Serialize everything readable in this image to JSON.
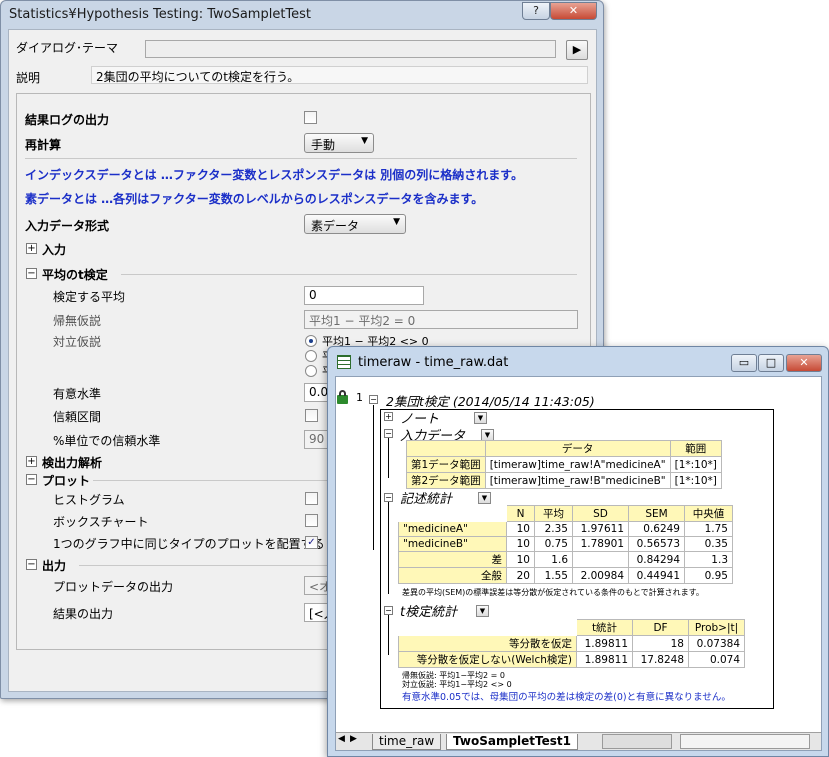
{
  "dialog": {
    "title": "Statistics¥Hypothesis Testing: TwoSampletTest",
    "help_label": "?",
    "close_label": "✕",
    "theme_label": "ダイアログ･テーマ",
    "theme_value": "",
    "theme_arrow": "▶",
    "desc_label": "説明",
    "desc_text": "2集団の平均についてのt検定を行う。",
    "result_log_label": "結果ログの出力",
    "recalc_label": "再計算",
    "recalc_value": "手動",
    "info1": "インデックスデータとは …ファクター変数とレスポンスデータは 別個の列に格納されます。",
    "info2": "素データとは …各列はファクター変数のレベルからのレスポンスデータを含みます。",
    "input_format_label": "入力データ形式",
    "input_format_value": "素データ",
    "input_section": "入力",
    "ttest_section": "平均のt検定",
    "mean_label": "検定する平均",
    "mean_value": "0",
    "null_label": "帰無仮説",
    "null_value": "平均1 − 平均2 = 0",
    "alt_label": "対立仮説",
    "alt_options": [
      "平均1 − 平均2 <> 0",
      "平",
      "平"
    ],
    "sig_label": "有意水準",
    "sig_value": "0.05",
    "ci_label": "信頼区間",
    "ci_level_label": "%単位での信頼水準",
    "ci_level_value": "90 9",
    "power_section": "検出力解析",
    "plot_section": "プロット",
    "histogram_label": "ヒストグラム",
    "boxchart_label": "ボックスチャート",
    "same_graph_label": "1つのグラフ中に同じタイプのプロットを配置する",
    "same_graph_check": "✓",
    "output_section": "出力",
    "plot_data_label": "プロットデータの出力",
    "plot_data_value": "<オ",
    "result_output_label": "結果の出力",
    "result_output_value": "[<入"
  },
  "workbook": {
    "title": "timeraw - time_raw.dat",
    "min_label": "▭",
    "max_label": "□",
    "close_label": "✕",
    "row_number": "1",
    "report_title": "2集団t検定 (2014/05/14 11:43:05)",
    "notes_label": "ノート",
    "input_label": "入力データ",
    "input_table": {
      "headers": [
        "データ",
        "範囲"
      ],
      "rows": [
        [
          "第1データ範囲",
          "[timeraw]time_raw!A\"medicineA\"",
          "[1*:10*]"
        ],
        [
          "第2データ範囲",
          "[timeraw]time_raw!B\"medicineB\"",
          "[1*:10*]"
        ]
      ]
    },
    "desc_stats_label": "記述統計",
    "desc_table": {
      "headers": [
        "",
        "N",
        "平均",
        "SD",
        "SEM",
        "中央値"
      ],
      "rows": [
        [
          "\"medicineA\"",
          "10",
          "2.35",
          "1.97611",
          "0.6249",
          "1.75"
        ],
        [
          "\"medicineB\"",
          "10",
          "0.75",
          "1.78901",
          "0.56573",
          "0.35"
        ],
        [
          "差",
          "10",
          "1.6",
          "",
          "0.84294",
          "1.3"
        ],
        [
          "全般",
          "20",
          "1.55",
          "2.00984",
          "0.44941",
          "0.95"
        ]
      ],
      "footnote": "差異の平均(SEM)の標準誤差は等分散が仮定されている条件のもとで計算されます。"
    },
    "ttest_label": "t検定統計",
    "ttest_table": {
      "headers": [
        "",
        "t統計",
        "DF",
        "Prob>|t|"
      ],
      "rows": [
        [
          "等分散を仮定",
          "1.89811",
          "18",
          "0.07384"
        ],
        [
          "等分散を仮定しない(Welch検定)",
          "1.89811",
          "17.8248",
          "0.074"
        ]
      ],
      "null_note": "帰無仮説: 平均1−平均2 = 0",
      "alt_note": "対立仮説: 平均1−平均2 <> 0",
      "conclusion": "有意水準0.05では、母集団の平均の差は検定の差(0)と有意に異なりません。"
    },
    "tabs": [
      "time_raw",
      "TwoSampletTest1"
    ],
    "nav_first": "◀",
    "nav_next": "▶"
  }
}
